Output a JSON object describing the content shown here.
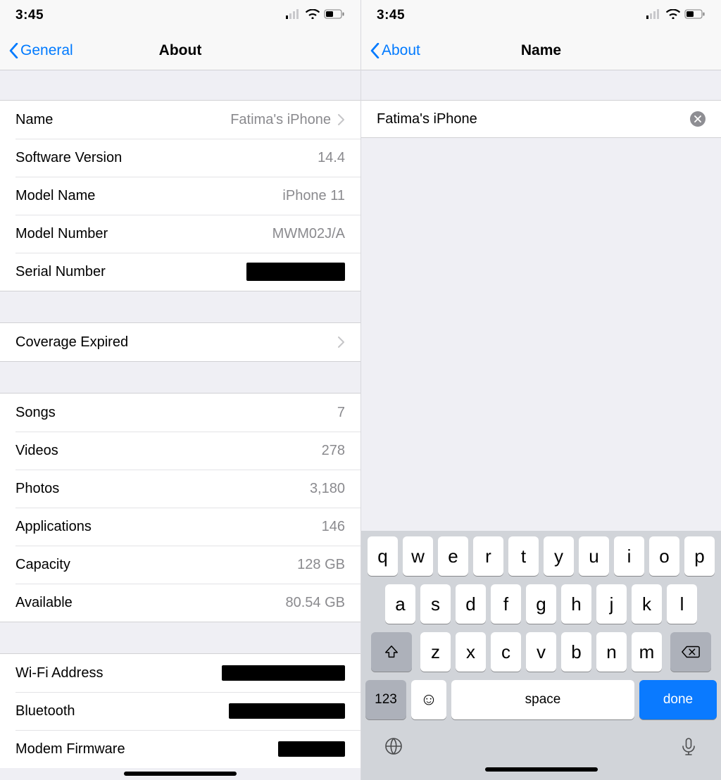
{
  "status": {
    "time": "3:45"
  },
  "left": {
    "back_label": "General",
    "title": "About",
    "rows1": [
      {
        "label": "Name",
        "value": "Fatima's iPhone",
        "chevron": true
      },
      {
        "label": "Software Version",
        "value": "14.4"
      },
      {
        "label": "Model Name",
        "value": "iPhone 11"
      },
      {
        "label": "Model Number",
        "value": "MWM02J/A"
      },
      {
        "label": "Serial Number",
        "redacted": true
      }
    ],
    "rows2": [
      {
        "label": "Coverage Expired",
        "chevron": true
      }
    ],
    "rows3": [
      {
        "label": "Songs",
        "value": "7"
      },
      {
        "label": "Videos",
        "value": "278"
      },
      {
        "label": "Photos",
        "value": "3,180"
      },
      {
        "label": "Applications",
        "value": "146"
      },
      {
        "label": "Capacity",
        "value": "128 GB"
      },
      {
        "label": "Available",
        "value": "80.54 GB"
      }
    ],
    "rows4": [
      {
        "label": "Wi-Fi Address",
        "redacted": true
      },
      {
        "label": "Bluetooth",
        "redacted": true
      },
      {
        "label": "Modem Firmware",
        "redacted": true
      }
    ]
  },
  "right": {
    "back_label": "About",
    "title": "Name",
    "input_value": "Fatima's iPhone"
  },
  "keyboard": {
    "row1": [
      "q",
      "w",
      "e",
      "r",
      "t",
      "y",
      "u",
      "i",
      "o",
      "p"
    ],
    "row2": [
      "a",
      "s",
      "d",
      "f",
      "g",
      "h",
      "j",
      "k",
      "l"
    ],
    "row3": [
      "z",
      "x",
      "c",
      "v",
      "b",
      "n",
      "m"
    ],
    "numbers_label": "123",
    "space_label": "space",
    "done_label": "done"
  }
}
